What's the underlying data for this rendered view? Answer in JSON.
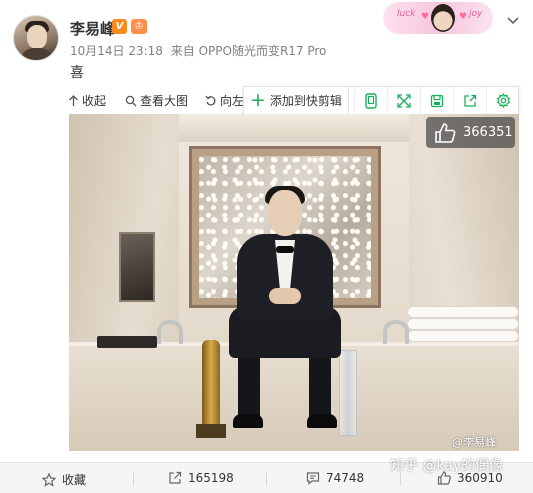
{
  "post": {
    "username": "李易峰",
    "verified_badge": "V",
    "member_badge": "♔",
    "date": "10月14日 23:18",
    "source": "来自 OPPO随光而变R17 Pro",
    "text": "喜"
  },
  "header_card": {
    "left_text": "luck",
    "right_text": "joy"
  },
  "toolbar": {
    "collapse_label": "收起",
    "view_large_label": "查看大图",
    "rotate_label": "向左"
  },
  "clip_popup": {
    "add_label": "添加到快剪辑",
    "icons": [
      "phone-icon",
      "expand-icon",
      "save-icon",
      "share-icon",
      "settings-icon"
    ],
    "accent": "#1aaf5d"
  },
  "photo": {
    "like_count": "366351",
    "watermark": "@李易峰"
  },
  "footer": {
    "favorite_label": "收藏",
    "repost_count": "165198",
    "comment_count": "74748",
    "like_count": "360910"
  },
  "overlay_watermark": "知乎 @kay的偶像"
}
